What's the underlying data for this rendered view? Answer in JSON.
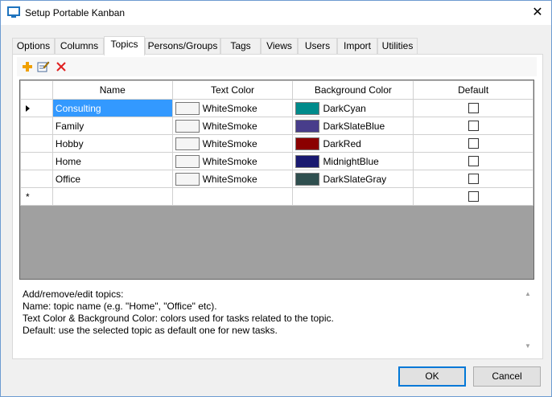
{
  "window": {
    "title": "Setup Portable Kanban",
    "close_glyph": "✕"
  },
  "tabs": [
    {
      "label": "Options"
    },
    {
      "label": "Columns"
    },
    {
      "label": "Topics"
    },
    {
      "label": "Persons/Groups"
    },
    {
      "label": "Tags"
    },
    {
      "label": "Views"
    },
    {
      "label": "Users"
    },
    {
      "label": "Import"
    },
    {
      "label": "Utilities"
    }
  ],
  "active_tab": "Topics",
  "toolbar": {
    "add": {
      "icon": "add-icon",
      "color": "#f0a000"
    },
    "edit": {
      "icon": "edit-icon"
    },
    "delete": {
      "icon": "delete-icon",
      "color": "#e02020"
    }
  },
  "grid": {
    "columns": {
      "name": "Name",
      "text_color": "Text Color",
      "background_color": "Background Color",
      "default": "Default"
    },
    "rows": [
      {
        "name": "Consulting",
        "text_color": "WhiteSmoke",
        "text_hex": "#f5f5f5",
        "bg_color": "DarkCyan",
        "bg_hex": "#008b8b",
        "default": false
      },
      {
        "name": "Family",
        "text_color": "WhiteSmoke",
        "text_hex": "#f5f5f5",
        "bg_color": "DarkSlateBlue",
        "bg_hex": "#483d8b",
        "default": false
      },
      {
        "name": "Hobby",
        "text_color": "WhiteSmoke",
        "text_hex": "#f5f5f5",
        "bg_color": "DarkRed",
        "bg_hex": "#8b0000",
        "default": false
      },
      {
        "name": "Home",
        "text_color": "WhiteSmoke",
        "text_hex": "#f5f5f5",
        "bg_color": "MidnightBlue",
        "bg_hex": "#191970",
        "default": false
      },
      {
        "name": "Office",
        "text_color": "WhiteSmoke",
        "text_hex": "#f5f5f5",
        "bg_color": "DarkSlateGray",
        "bg_hex": "#2f4f4f",
        "default": false
      }
    ],
    "new_row_marker": "*",
    "current_row_marker": "row-pointer-icon",
    "selected_cell": "Consulting"
  },
  "help": {
    "lines": [
      "Add/remove/edit topics:",
      "Name: topic name (e.g. \"Home\", \"Office\" etc).",
      "Text Color & Background Color: colors used for tasks related to the topic.",
      "Default: use the selected topic as default one for new tasks."
    ]
  },
  "buttons": {
    "ok": "OK",
    "cancel": "Cancel"
  }
}
